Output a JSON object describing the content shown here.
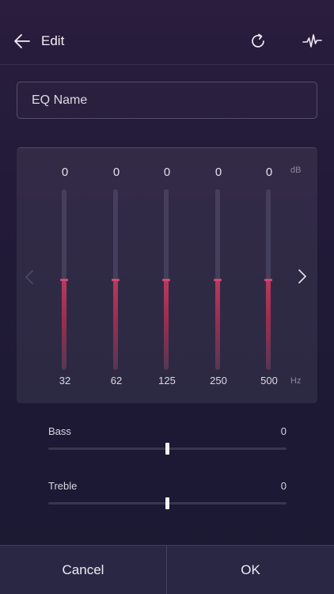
{
  "header": {
    "title": "Edit",
    "icons": [
      "back-arrow-icon",
      "reset-icon",
      "waveform-icon"
    ]
  },
  "eq_name": {
    "placeholder": "EQ Name",
    "value": ""
  },
  "equalizer": {
    "db_unit": "dB",
    "hz_unit": "Hz",
    "gain_range_db": [
      -12,
      12
    ],
    "bands": [
      {
        "freq": "32",
        "gain": "0",
        "gain_value": 0
      },
      {
        "freq": "62",
        "gain": "0",
        "gain_value": 0
      },
      {
        "freq": "125",
        "gain": "0",
        "gain_value": 0
      },
      {
        "freq": "250",
        "gain": "0",
        "gain_value": 0
      },
      {
        "freq": "500",
        "gain": "0",
        "gain_value": 0
      }
    ],
    "nav_icons": [
      "chevron-left-icon",
      "chevron-right-icon"
    ]
  },
  "tone": {
    "range": [
      -10,
      10
    ],
    "bass": {
      "label": "Bass",
      "value": "0",
      "level": 0
    },
    "treble": {
      "label": "Treble",
      "value": "0",
      "level": 0
    }
  },
  "footer": {
    "cancel_label": "Cancel",
    "ok_label": "OK"
  },
  "colors": {
    "accent": "#c03b62",
    "background": "#221a38",
    "panel": "#2c2946"
  }
}
